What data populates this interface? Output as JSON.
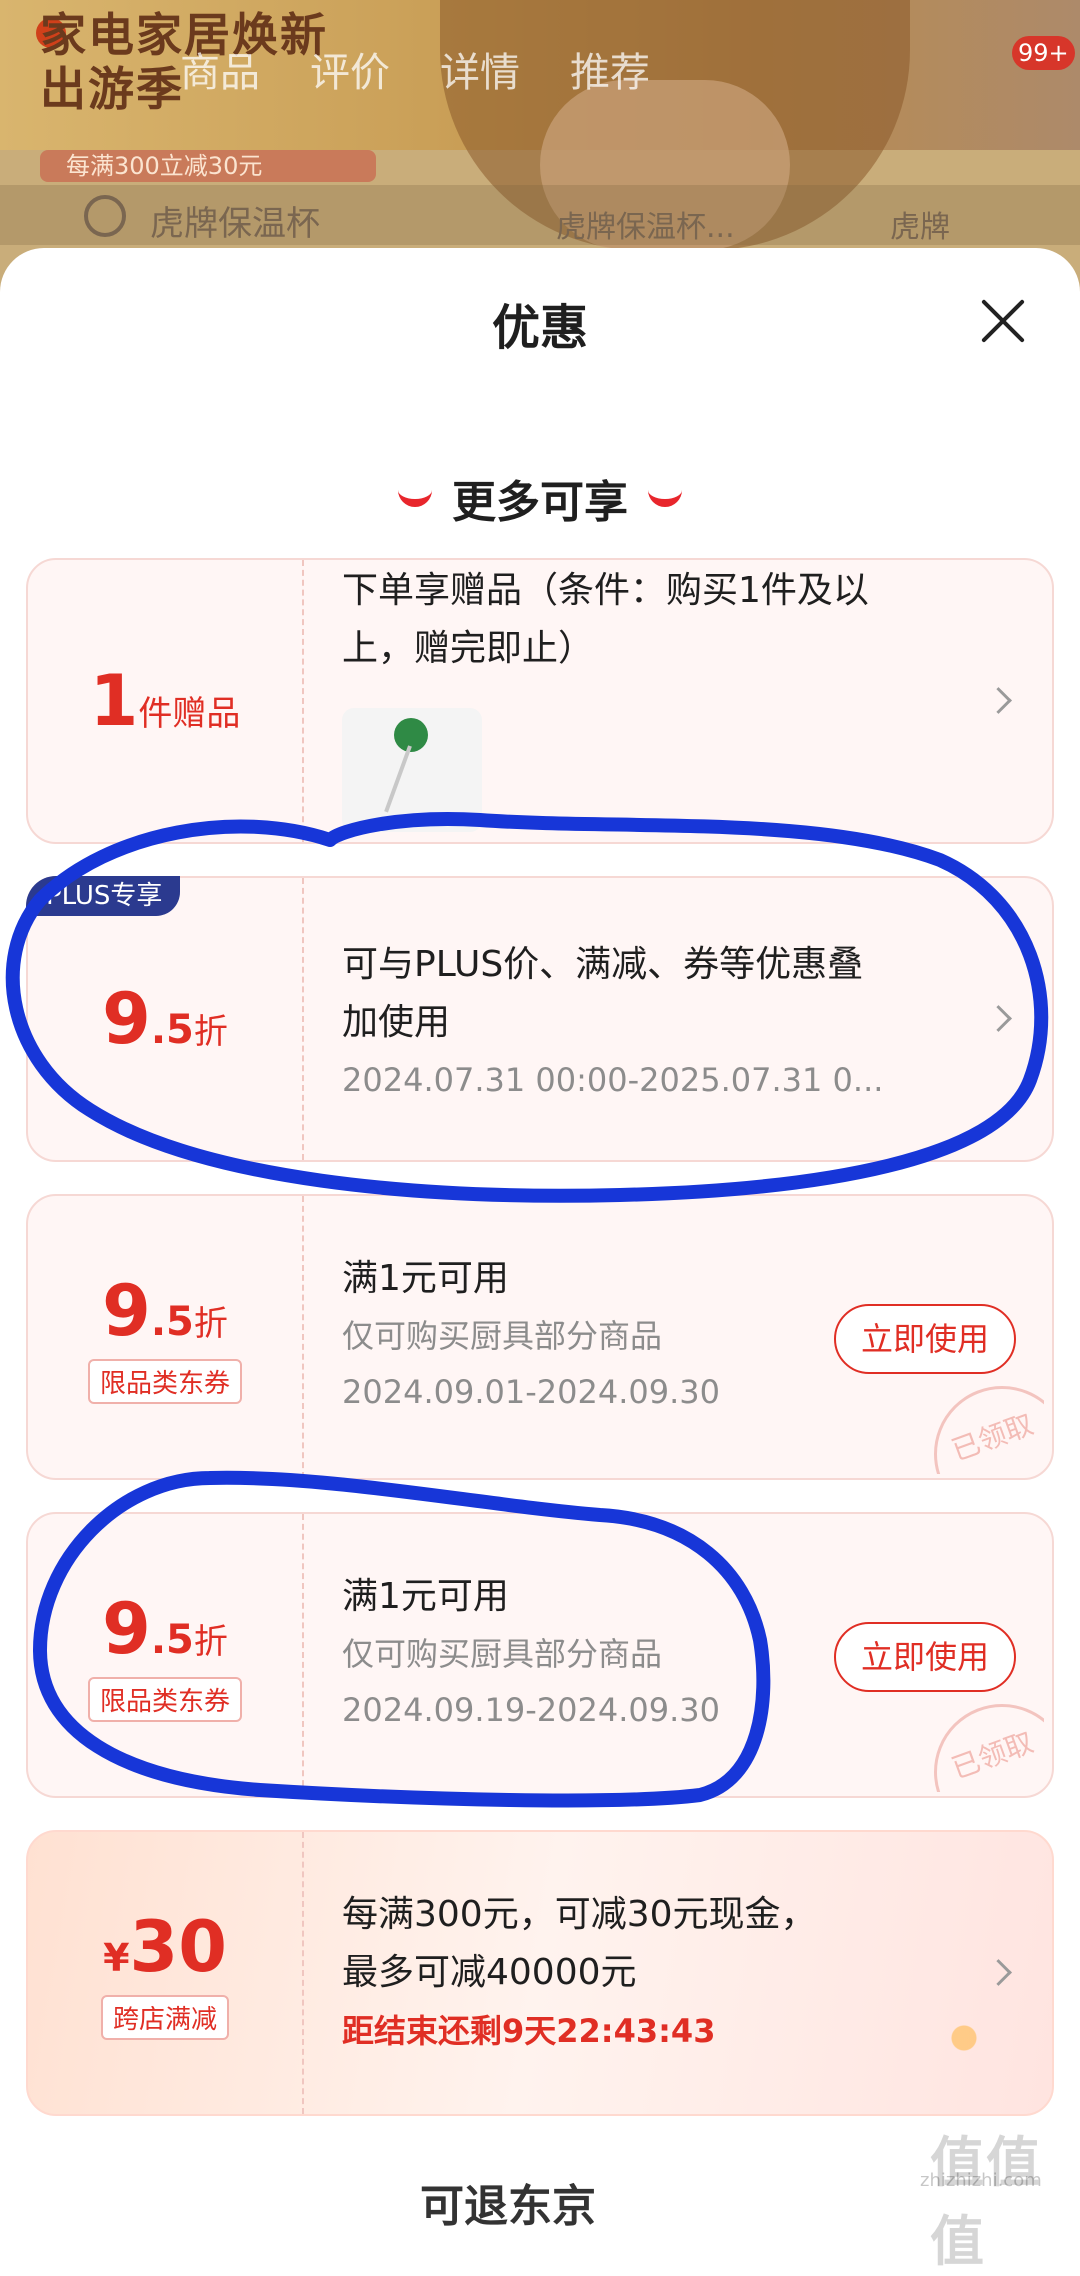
{
  "background": {
    "promo_title": "家电家居焕新出游季",
    "tabs": [
      "商品",
      "评价",
      "详情",
      "推荐"
    ],
    "cart_badge": "99+",
    "promo_strip": "每满300立减30元",
    "search_text": "虎牌保温杯",
    "recommend": [
      "虎牌保温杯...",
      "虎牌"
    ]
  },
  "sheet": {
    "title": "优惠",
    "section_title": "更多可享"
  },
  "cards": {
    "gift": {
      "count": "1",
      "unit": "件赠品",
      "description": "下单享赠品（条件：购买1件及以上，赠完即止）"
    },
    "plus": {
      "tag": "PLUS专享",
      "value_int": "9",
      "value_dec": ".5",
      "unit": "折",
      "description": "可与PLUS价、满减、券等优惠叠加使用",
      "validity": "2024.07.31 00:00-2025.07.31 0..."
    },
    "coupon1": {
      "value_int": "9",
      "value_dec": ".5",
      "unit": "折",
      "tag": "限品类东券",
      "condition": "满1元可用",
      "scope": "仅可购买厨具部分商品",
      "validity": "2024.09.01-2024.09.30",
      "button": "立即使用",
      "stamp": "已领取"
    },
    "coupon2": {
      "value_int": "9",
      "value_dec": ".5",
      "unit": "折",
      "tag": "限品类东券",
      "condition": "满1元可用",
      "scope": "仅可购买厨具部分商品",
      "validity": "2024.09.19-2024.09.30",
      "button": "立即使用",
      "stamp": "已领取"
    },
    "cross": {
      "currency": "¥",
      "amount": "30",
      "tag": "跨店满减",
      "line1": "每满300元，可减30元现金，",
      "line2": "最多可减40000元",
      "countdown": "距结束还剩9天22:43:43"
    }
  },
  "footer": {
    "peek_text": "可退东京",
    "watermark": "值值值",
    "watermark_url": "zhizhizhi.com"
  },
  "colors": {
    "accent_red": "#e02e24",
    "plus_blue": "#2b3a8f",
    "annotation_blue": "#1736d8"
  }
}
